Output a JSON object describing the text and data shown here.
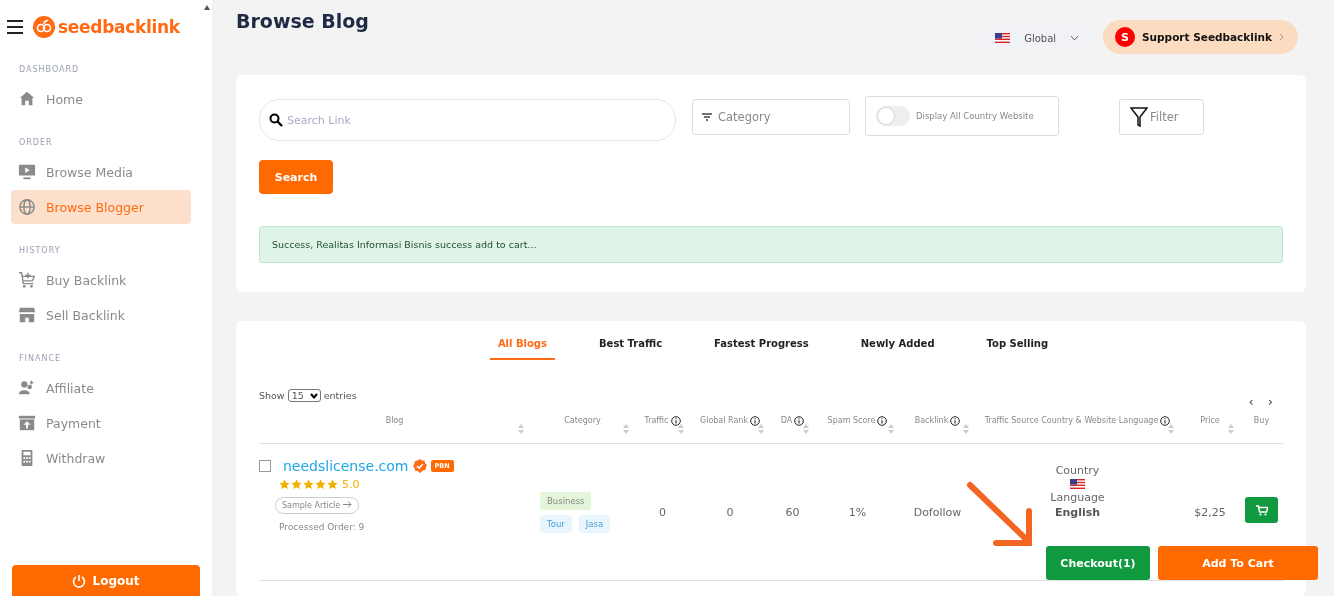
{
  "sidebar": {
    "logo": "seedbacklink",
    "sections": [
      {
        "title": "DASHBOARD",
        "items": [
          {
            "label": "Home",
            "selected": false
          }
        ]
      },
      {
        "title": "ORDER",
        "items": [
          {
            "label": "Browse Media",
            "selected": false
          },
          {
            "label": "Browse Blogger",
            "selected": true
          }
        ]
      },
      {
        "title": "HISTORY",
        "items": [
          {
            "label": "Buy Backlink",
            "selected": false
          },
          {
            "label": "Sell Backlink",
            "selected": false
          }
        ]
      },
      {
        "title": "FINANCE",
        "items": [
          {
            "label": "Affiliate",
            "selected": false
          },
          {
            "label": "Payment",
            "selected": false
          },
          {
            "label": "Withdraw",
            "selected": false
          }
        ]
      }
    ],
    "logout": "Logout"
  },
  "page_title": "Browse Blog",
  "region": {
    "label": "Global"
  },
  "support": {
    "avatar": "S",
    "label": "Support Seedbacklink"
  },
  "filters": {
    "search": {
      "placeholder": "Search Link"
    },
    "category": {
      "placeholder": "Category"
    },
    "country_toggle": {
      "label": "Display All Country Website",
      "on": false
    },
    "filter_button": "Filter",
    "search_button": "Search"
  },
  "alert": "Success, Realitas Informasi Bisnis success add to cart...",
  "tabs": [
    {
      "label": "All Blogs",
      "selected": true
    },
    {
      "label": "Best Traffic",
      "selected": false
    },
    {
      "label": "Fastest Progress",
      "selected": false
    },
    {
      "label": "Newly Added",
      "selected": false
    },
    {
      "label": "Top Selling",
      "selected": false
    }
  ],
  "entries": {
    "show": "Show",
    "value": "15",
    "suffix": "entries"
  },
  "pagination": {
    "prev": "‹",
    "next": "›"
  },
  "table": {
    "columns": [
      {
        "label": "Blog",
        "info": false,
        "sortable": true
      },
      {
        "label": "Category",
        "info": false,
        "sortable": true
      },
      {
        "label": "Traffic",
        "info": true,
        "sortable": true
      },
      {
        "label": "Global Rank",
        "info": true,
        "sortable": true
      },
      {
        "label": "DA",
        "info": true,
        "sortable": true
      },
      {
        "label": "Spam Score",
        "info": true,
        "sortable": true
      },
      {
        "label": "Backlink",
        "info": true,
        "sortable": true
      },
      {
        "label": "Traffic Source Country & Website Language",
        "info": true,
        "sortable": true
      },
      {
        "label": "Price",
        "info": false,
        "sortable": true
      },
      {
        "label": "Buy",
        "info": false,
        "sortable": false
      }
    ],
    "rows": [
      {
        "checked": false,
        "domain": "needslicense.com",
        "verified": true,
        "badge": "PBN",
        "stars": 5,
        "rating": "5.0",
        "sample": "Sample Article",
        "processed": "Processed Order: 9",
        "categories": [
          {
            "label": "Business",
            "color": "#e4f6d9"
          },
          {
            "label": "Tour",
            "color": "#e9f5fd"
          },
          {
            "label": "Jasa",
            "color": "#e9f5fd"
          }
        ],
        "traffic": "0",
        "global_rank": "0",
        "da": "60",
        "spam_score": "1%",
        "backlink": "Dofollow",
        "country_label": "Country",
        "language_label": "Language",
        "language": "English",
        "price": "$2,25"
      }
    ]
  },
  "cart_actions": {
    "checkout": "Checkout(1)",
    "add": "Add To Cart"
  }
}
